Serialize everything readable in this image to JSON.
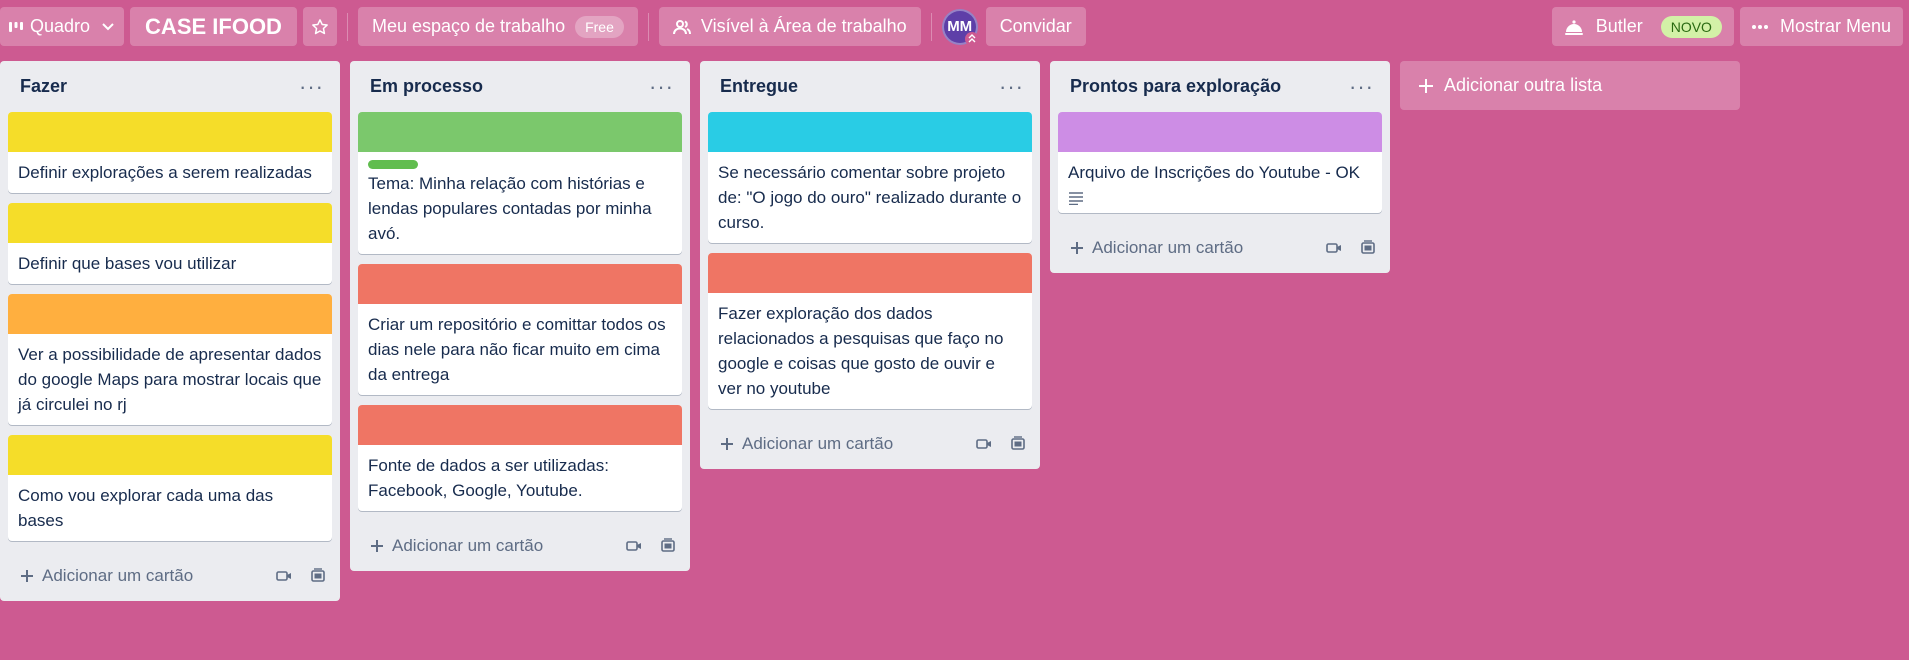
{
  "header": {
    "view_label": "Quadro",
    "board_title": "CASE IFOOD",
    "workspace_label": "Meu espaço de trabalho",
    "workspace_badge": "Free",
    "visibility_label": "Visível à Área de trabalho",
    "member_initials": "MM",
    "invite_label": "Convidar",
    "butler_label": "Butler",
    "butler_badge": "NOVO",
    "menu_label": "Mostrar Menu"
  },
  "colors": {
    "background": "#cd5a91",
    "yellow": "#f5dd29",
    "orange": "#ffaf3f",
    "green": "#7bc86c",
    "green_label": "#61bd4f",
    "red": "#ef7564",
    "sky": "#29cce5",
    "purple": "#cd8de5"
  },
  "icons": {
    "view": "board-icon",
    "star": "star-icon",
    "visibility": "people-icon",
    "butler": "butler-bell-icon",
    "menu": "more-icon",
    "add": "plus-icon",
    "video": "video-icon",
    "template": "card-template-icon",
    "description": "description-icon"
  },
  "lists": [
    {
      "title": "Fazer",
      "cards": [
        {
          "cover": "yellow",
          "text": "Definir explorações a serem realizadas"
        },
        {
          "cover": "yellow",
          "text": "Definir que bases vou utilizar"
        },
        {
          "cover": "orange",
          "text": "Ver a possibilidade de apresentar dados do google Maps para mostrar locais que já circulei no rj"
        },
        {
          "cover": "yellow",
          "text": "Como vou explorar cada uma das bases"
        }
      ],
      "add_card_label": "Adicionar um cartão"
    },
    {
      "title": "Em processo",
      "cards": [
        {
          "cover": "green",
          "label": "green_label",
          "text": "Tema: Minha relação com histórias e lendas populares contadas por minha avó."
        },
        {
          "cover": "red",
          "text": "Criar um repositório e comittar todos os dias nele para não ficar muito em cima da entrega"
        },
        {
          "cover": "red",
          "text": "Fonte de dados a ser utilizadas: Facebook, Google, Youtube."
        }
      ],
      "add_card_label": "Adicionar um cartão"
    },
    {
      "title": "Entregue",
      "cards": [
        {
          "cover": "sky",
          "text": "Se necessário comentar sobre projeto de: \"O jogo do ouro\" realizado durante o curso."
        },
        {
          "cover": "red",
          "text": "Fazer exploração dos dados relacionados a pesquisas que faço no google e coisas que gosto de ouvir e ver no youtube"
        }
      ],
      "add_card_label": "Adicionar um cartão"
    },
    {
      "title": "Prontos para exploração",
      "cards": [
        {
          "cover": "purple",
          "text": "Arquivo de Inscrições do Youtube - OK",
          "has_description": true
        }
      ],
      "add_card_label": "Adicionar um cartão"
    }
  ],
  "add_list_label": "Adicionar outra lista"
}
